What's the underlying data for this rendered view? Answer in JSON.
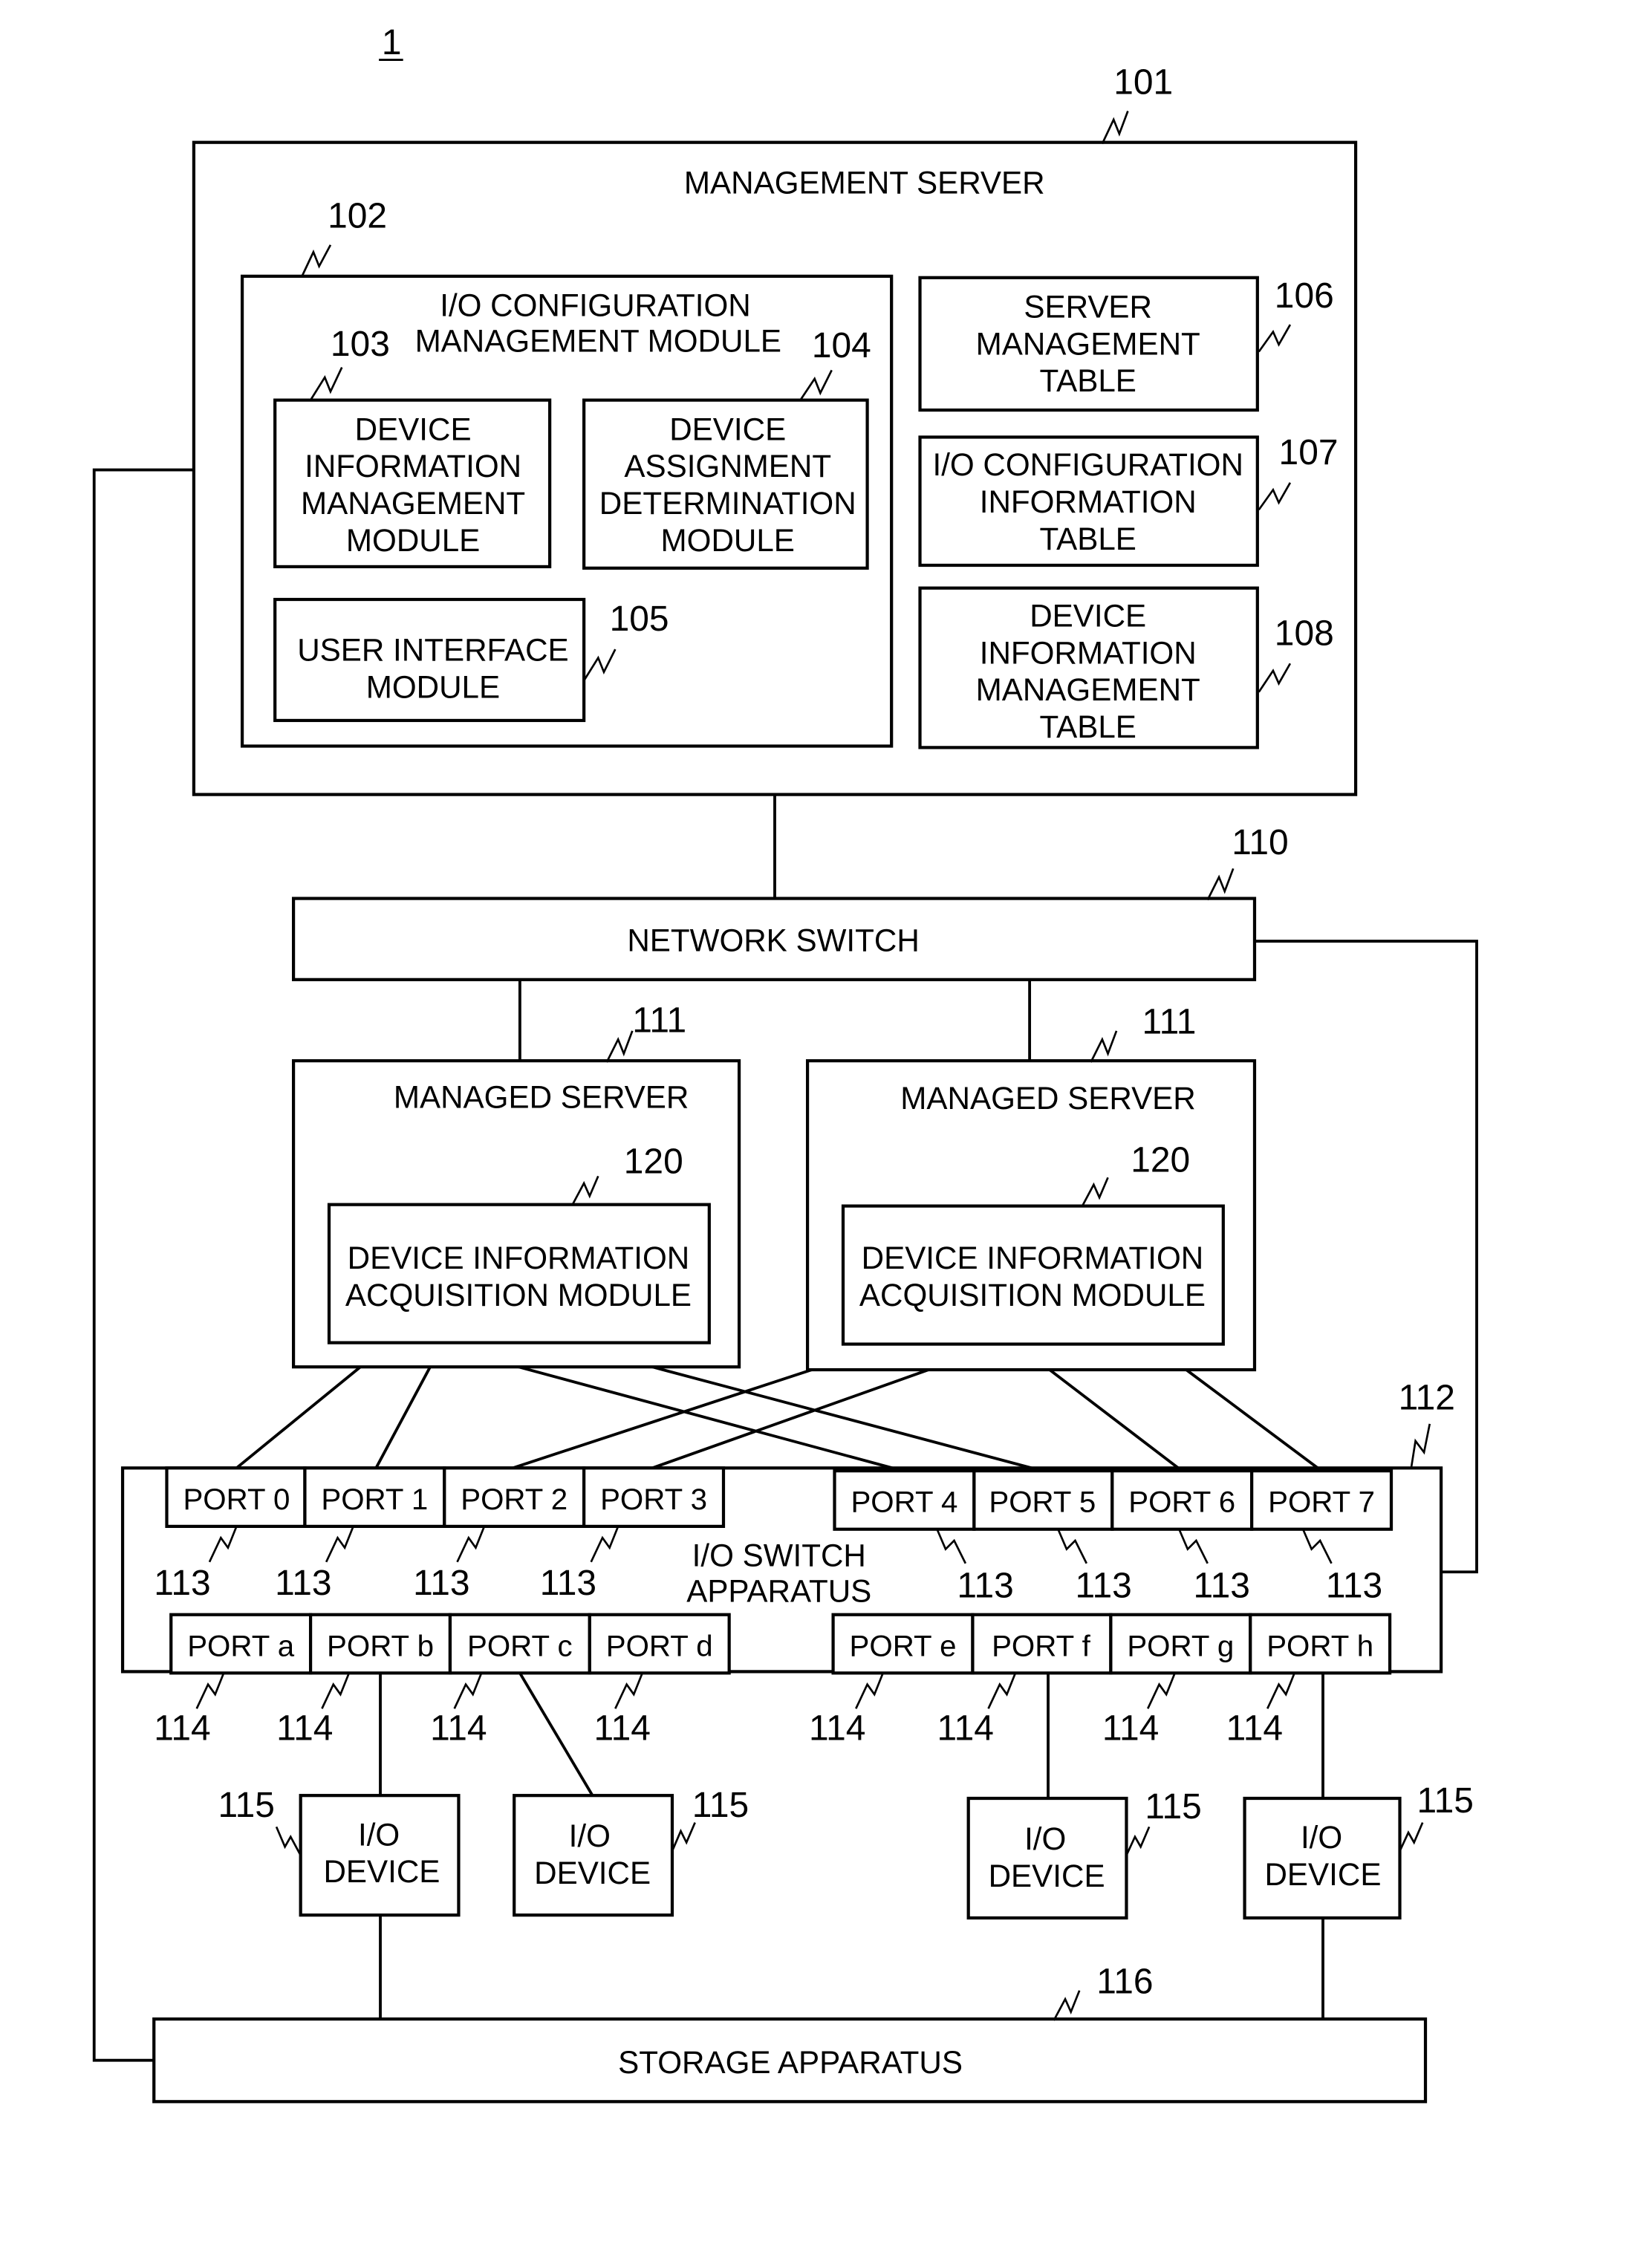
{
  "figure_label": "1",
  "management_server": {
    "ref": "101",
    "title": "MANAGEMENT SERVER",
    "io_config_module": {
      "ref": "102",
      "title_lines": [
        "I/O CONFIGURATION",
        "MANAGEMENT MODULE"
      ],
      "device_info_mgmt_module": {
        "ref": "103",
        "lines": [
          "DEVICE",
          "INFORMATION",
          "MANAGEMENT",
          "MODULE"
        ]
      },
      "device_assignment_module": {
        "ref": "104",
        "lines": [
          "DEVICE",
          "ASSIGNMENT",
          "DETERMINATION",
          "MODULE"
        ]
      },
      "user_interface_module": {
        "ref": "105",
        "lines": [
          "USER INTERFACE",
          "MODULE"
        ]
      }
    },
    "tables": [
      {
        "ref": "106",
        "lines": [
          "SERVER",
          "MANAGEMENT",
          "TABLE"
        ]
      },
      {
        "ref": "107",
        "lines": [
          "I/O CONFIGURATION",
          "INFORMATION",
          "TABLE"
        ]
      },
      {
        "ref": "108",
        "lines": [
          "DEVICE",
          "INFORMATION",
          "MANAGEMENT",
          "TABLE"
        ]
      }
    ]
  },
  "network_switch": {
    "ref": "110",
    "label": "NETWORK SWITCH"
  },
  "managed_servers": [
    {
      "ref": "111",
      "title": "MANAGED SERVER",
      "module": {
        "ref": "120",
        "lines": [
          "DEVICE INFORMATION",
          "ACQUISITION MODULE"
        ]
      }
    },
    {
      "ref": "111",
      "title": "MANAGED SERVER",
      "module": {
        "ref": "120",
        "lines": [
          "DEVICE INFORMATION",
          "ACQUISITION MODULE"
        ]
      }
    }
  ],
  "io_switch": {
    "ref": "112",
    "title_lines": [
      "I/O SWITCH",
      "APPARATUS"
    ],
    "upstream_port_ref": "113",
    "downstream_port_ref": "114",
    "upstream_ports": [
      "PORT 0",
      "PORT 1",
      "PORT 2",
      "PORT 3",
      "PORT 4",
      "PORT 5",
      "PORT 6",
      "PORT 7"
    ],
    "downstream_ports": [
      "PORT a",
      "PORT b",
      "PORT c",
      "PORT d",
      "PORT e",
      "PORT f",
      "PORT g",
      "PORT h"
    ]
  },
  "io_devices": [
    {
      "ref": "115",
      "lines": [
        "I/O",
        "DEVICE"
      ]
    },
    {
      "ref": "115",
      "lines": [
        "I/O",
        "DEVICE"
      ]
    },
    {
      "ref": "115",
      "lines": [
        "I/O",
        "DEVICE"
      ]
    },
    {
      "ref": "115",
      "lines": [
        "I/O",
        "DEVICE"
      ]
    }
  ],
  "storage": {
    "ref": "116",
    "label": "STORAGE APPARATUS"
  }
}
